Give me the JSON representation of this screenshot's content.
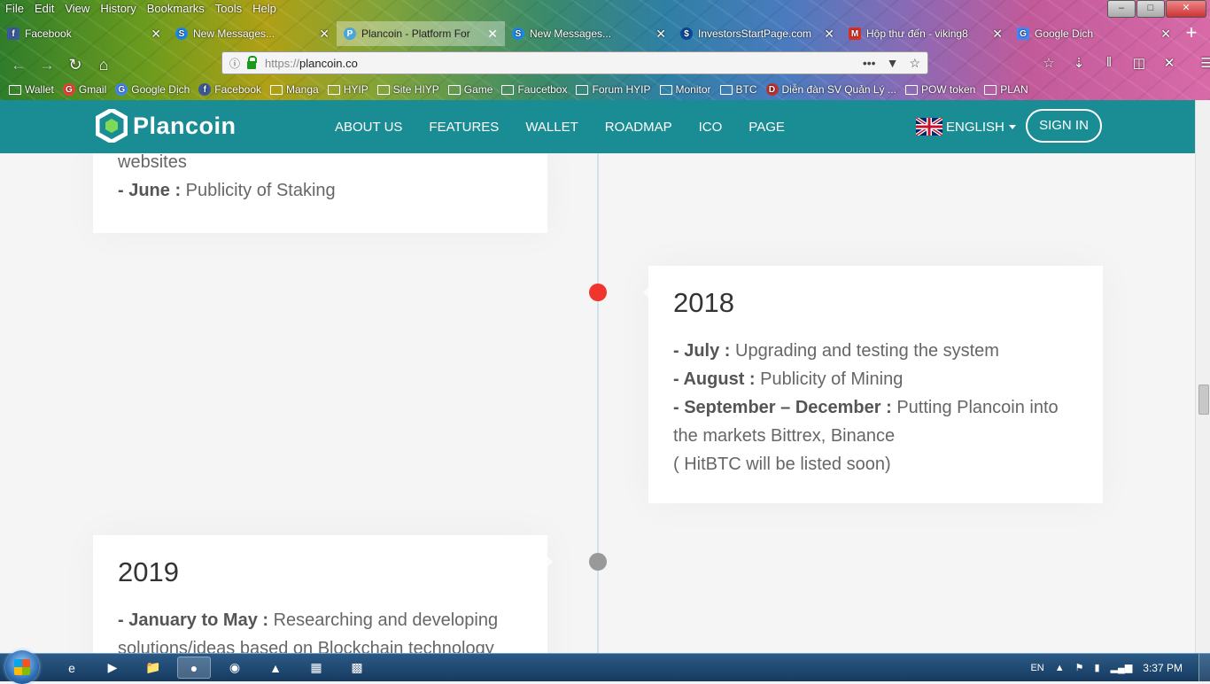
{
  "browser": {
    "menu": [
      "File",
      "Edit",
      "View",
      "History",
      "Bookmarks",
      "Tools",
      "Help"
    ],
    "tabs": [
      {
        "label": "Facebook",
        "icon_letter": "f",
        "icon_color": "#3b5998",
        "active": false
      },
      {
        "label": "New Messages...",
        "icon_letter": "S",
        "icon_color": "#1e88e5",
        "active": false
      },
      {
        "label": "Plancoin - Platform For",
        "icon_letter": "P",
        "icon_color": "#4aa6d6",
        "active": true
      },
      {
        "label": "New Messages...",
        "icon_letter": "S",
        "icon_color": "#1e88e5",
        "active": false
      },
      {
        "label": "InvestorsStartPage.com",
        "icon_letter": "$",
        "icon_color": "#0a4a9a",
        "active": false
      },
      {
        "label": "Hộp thư đến - viking8",
        "icon_letter": "M",
        "icon_color": "#d93025",
        "active": false
      },
      {
        "label": "Google Dịch",
        "icon_letter": "G",
        "icon_color": "#4285f4",
        "active": false
      }
    ],
    "url": "https://plancoin.co",
    "url_prefix": "https://",
    "url_host": "plancoin.co",
    "bookmarks": [
      {
        "label": "Wallet",
        "type": "folder"
      },
      {
        "label": "Gmail",
        "type": "google"
      },
      {
        "label": "Google Dịch",
        "type": "translate"
      },
      {
        "label": "Facebook",
        "type": "facebook"
      },
      {
        "label": "Manga",
        "type": "folder"
      },
      {
        "label": "HYIP",
        "type": "folder"
      },
      {
        "label": "Site HIYP",
        "type": "folder"
      },
      {
        "label": "Game",
        "type": "folder"
      },
      {
        "label": "Faucetbox",
        "type": "folder"
      },
      {
        "label": "Forum HYIP",
        "type": "folder"
      },
      {
        "label": "Monitor",
        "type": "folder"
      },
      {
        "label": "BTC",
        "type": "folder"
      },
      {
        "label": "Diễn đàn SV Quản Lý ...",
        "type": "site"
      },
      {
        "label": "POW token",
        "type": "folder"
      },
      {
        "label": "PLAN",
        "type": "folder"
      }
    ]
  },
  "site": {
    "logo_text": "Plancoin",
    "nav": [
      "ABOUT US",
      "FEATURES",
      "WALLET",
      "ROADMAP",
      "ICO",
      "PAGE"
    ],
    "language": "ENGLISH",
    "signin": "SIGN IN",
    "accent": "#1a8c93"
  },
  "timeline": {
    "card_2017_tail": {
      "line1": "websites",
      "item_label": "- June :",
      "item_text": " Publicity of Staking"
    },
    "card_2018": {
      "year": "2018",
      "items": [
        {
          "label": "- July :",
          "text": " Upgrading and testing the system"
        },
        {
          "label": "- August :",
          "text": " Publicity of Mining"
        },
        {
          "label": "- September – December :",
          "text": " Putting Plancoin into the markets Bittrex, Binance"
        }
      ],
      "note": "( HitBTC will be listed soon)",
      "dot_color": "#f0352e"
    },
    "card_2019": {
      "year": "2019",
      "item_label": "- January to May :",
      "item_text": " Researching and developing solutions/ideas based on Blockchain technology",
      "dot_color": "#999999"
    }
  },
  "taskbar": {
    "lang": "EN",
    "time": "3:37 PM"
  }
}
